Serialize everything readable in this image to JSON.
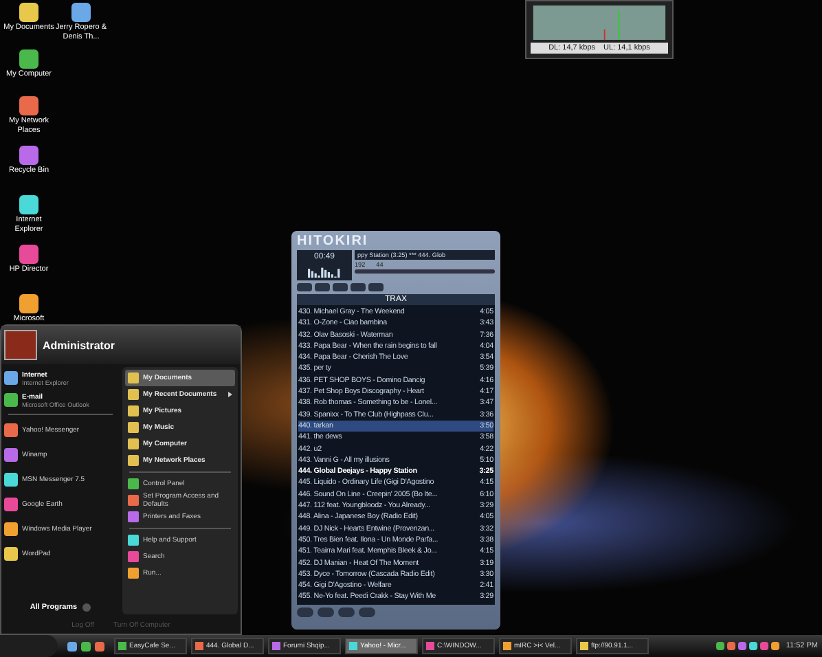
{
  "desktop_icons": [
    {
      "label": "My Documents"
    },
    {
      "label": "Jerry Ropero & Denis Th..."
    },
    {
      "label": "My Computer"
    },
    {
      "label": "My Network Places"
    },
    {
      "label": "Recycle Bin"
    },
    {
      "label": "Internet Explorer"
    },
    {
      "label": "HP Director"
    },
    {
      "label": "Microsoft"
    }
  ],
  "net_meter": {
    "download": "DL: 14,7 kbps",
    "upload": "UL: 14,1 kbps"
  },
  "start_menu": {
    "user": "Administrator",
    "pinned": [
      {
        "title": "Internet",
        "subtitle": "Internet Explorer"
      },
      {
        "title": "E-mail",
        "subtitle": "Microsoft Office Outlook"
      }
    ],
    "recent": [
      "Yahoo! Messenger",
      "Winamp",
      "MSN Messenger 7.5",
      "Google Earth",
      "Windows Media Player",
      "WordPad"
    ],
    "all_programs": "All Programs",
    "places": [
      {
        "label": "My Documents",
        "selected": true,
        "submenu": false
      },
      {
        "label": "My Recent Documents",
        "selected": false,
        "submenu": true
      },
      {
        "label": "My Pictures",
        "selected": false,
        "submenu": false
      },
      {
        "label": "My Music",
        "selected": false,
        "submenu": false
      },
      {
        "label": "My Computer",
        "selected": false,
        "submenu": false
      },
      {
        "label": "My Network Places",
        "selected": false,
        "submenu": false
      }
    ],
    "settings": [
      "Control Panel",
      "Set Program Access and Defaults",
      "Printers and Faxes"
    ],
    "help": [
      "Help and Support",
      "Search",
      "Run..."
    ],
    "footer": [
      "Log Off",
      "Turn Off Computer"
    ]
  },
  "player": {
    "skin": "HITOKIRI",
    "time": "00:49",
    "marquee": "ppy Station (3:25) *** 444. Glob",
    "kbps": "192",
    "khz": "44",
    "playlist_title": "TRAX",
    "tracks": [
      {
        "title": "430. Michael Gray - The Weekend",
        "length": "4:05",
        "selected": false,
        "playing": false
      },
      {
        "title": "431. O-Zone - Ciao bambina",
        "length": "3:43",
        "selected": false,
        "playing": false
      },
      {
        "title": "432. Olav Basoski - Waterman",
        "length": "7:36",
        "selected": false,
        "playing": false
      },
      {
        "title": "433. Papa Bear - When the rain begins to fall",
        "length": "4:04",
        "selected": false,
        "playing": false
      },
      {
        "title": "434. Papa Bear - Cherish The Love",
        "length": "3:54",
        "selected": false,
        "playing": false
      },
      {
        "title": "435. per ty",
        "length": "5:39",
        "selected": false,
        "playing": false
      },
      {
        "title": "436. PET SHOP BOYS - Domino Dancig",
        "length": "4:16",
        "selected": false,
        "playing": false
      },
      {
        "title": "437. Pet Shop Boys Discography - Heart",
        "length": "4:17",
        "selected": false,
        "playing": false
      },
      {
        "title": "438. Rob thomas - Something to be - Lonel...",
        "length": "3:47",
        "selected": false,
        "playing": false
      },
      {
        "title": "439. Spanixx - To The Club (Highpass Clu...",
        "length": "3:36",
        "selected": false,
        "playing": false
      },
      {
        "title": "440. tarkan",
        "length": "3:50",
        "selected": true,
        "playing": false
      },
      {
        "title": "441. the dews",
        "length": "3:58",
        "selected": false,
        "playing": false
      },
      {
        "title": "442. u2",
        "length": "4:22",
        "selected": false,
        "playing": false
      },
      {
        "title": "443. Vanni G - All my illusions",
        "length": "5:10",
        "selected": false,
        "playing": false
      },
      {
        "title": "444. Global Deejays - Happy Station",
        "length": "3:25",
        "selected": false,
        "playing": true
      },
      {
        "title": "445. Liquido - Ordinary Life (Gigi D'Agostino",
        "length": "4:15",
        "selected": false,
        "playing": false
      },
      {
        "title": "446. Sound On Line - Creepin' 2005 (Bo Ite...",
        "length": "6:10",
        "selected": false,
        "playing": false
      },
      {
        "title": "447. 112 feat. Youngbloodz - You Already...",
        "length": "3:29",
        "selected": false,
        "playing": false
      },
      {
        "title": "448. Alina - Japanese Boy (Radio Edit)",
        "length": "4:05",
        "selected": false,
        "playing": false
      },
      {
        "title": "449. DJ Nick - Hearts Entwine (Provenzan...",
        "length": "3:32",
        "selected": false,
        "playing": false
      },
      {
        "title": "450. Tres Bien feat. Ilona - Un Monde Parfa...",
        "length": "3:38",
        "selected": false,
        "playing": false
      },
      {
        "title": "451. Teairra Mari feat. Memphis Bleek & Jo...",
        "length": "4:15",
        "selected": false,
        "playing": false
      },
      {
        "title": "452. DJ Manian - Heat Of The Moment",
        "length": "3:19",
        "selected": false,
        "playing": false
      },
      {
        "title": "453. Dyce - Tomorrow (Cascada Radio Edit)",
        "length": "3:30",
        "selected": false,
        "playing": false
      },
      {
        "title": "454. Gigi D'Agostino - Welfare",
        "length": "2:41",
        "selected": false,
        "playing": false
      },
      {
        "title": "455. Ne-Yo feat. Peedi Crakk - Stay With Me",
        "length": "3:29",
        "selected": false,
        "playing": false
      }
    ]
  },
  "taskbar": {
    "tasks": [
      {
        "label": "EasyCafe Se...",
        "selected": false
      },
      {
        "label": "444. Global D...",
        "selected": false
      },
      {
        "label": "Forumi Shqip...",
        "selected": false
      },
      {
        "label": "Yahoo! - Micr...",
        "selected": true
      },
      {
        "label": "C:\\WINDOW...",
        "selected": false
      },
      {
        "label": "mIRC >i< Vel...",
        "selected": false
      },
      {
        "label": "ftp://90.91.1...",
        "selected": false
      }
    ],
    "clock": "11:52 PM"
  }
}
